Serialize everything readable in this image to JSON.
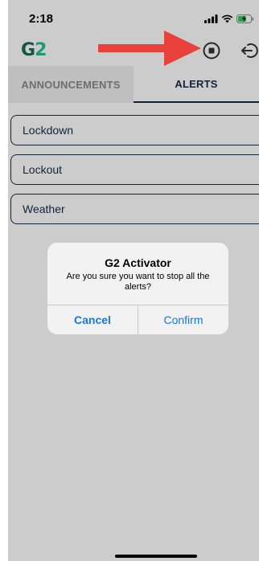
{
  "status_bar": {
    "time": "2:18",
    "icons": [
      "signal-icon",
      "wifi-icon",
      "battery-charging-icon"
    ]
  },
  "header": {
    "logo": {
      "part1": "G",
      "part2": "2"
    },
    "actions": [
      {
        "name": "stop-alerts-icon"
      },
      {
        "name": "logout-icon"
      }
    ]
  },
  "tabs": [
    {
      "label": "ANNOUNCEMENTS",
      "active": false
    },
    {
      "label": "ALERTS",
      "active": true
    }
  ],
  "alerts": [
    {
      "label": "Lockdown"
    },
    {
      "label": "Lockout"
    },
    {
      "label": "Weather"
    }
  ],
  "dialog": {
    "title": "G2 Activator",
    "message": "Are you sure you want to stop all the alerts?",
    "cancel_label": "Cancel",
    "confirm_label": "Confirm"
  },
  "colors": {
    "navy": "#1c2c45",
    "ios_blue": "#1a78e0",
    "logo_dark": "#1f6a55",
    "logo_light": "#2bbf8b",
    "arrow_red": "#e8403a"
  }
}
